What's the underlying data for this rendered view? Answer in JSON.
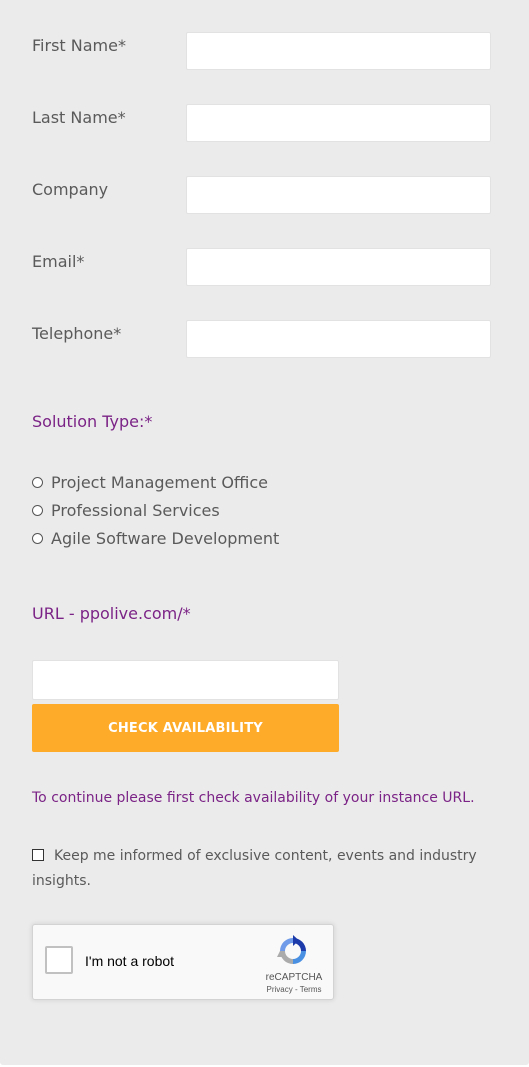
{
  "form": {
    "fields": [
      {
        "label": "First Name*",
        "value": ""
      },
      {
        "label": "Last Name*",
        "value": ""
      },
      {
        "label": "Company",
        "value": ""
      },
      {
        "label": "Email*",
        "value": ""
      },
      {
        "label": "Telephone*",
        "value": ""
      }
    ],
    "solution": {
      "title": "Solution Type:*",
      "options": [
        "Project Management Office",
        "Professional Services",
        "Agile Software Development"
      ]
    },
    "url": {
      "title": "URL - ppolive.com/*",
      "value": "",
      "button_label": "CHECK AVAILABILITY",
      "notice": "To continue please first check availability of your instance URL."
    },
    "consent": {
      "checked": false,
      "text": "Keep me informed of exclusive content, events and industry insights."
    },
    "captcha": {
      "label": "I'm not a robot",
      "brand": "reCAPTCHA",
      "privacy": "Privacy",
      "separator": " - ",
      "terms": "Terms"
    }
  },
  "colors": {
    "accent_purple": "#7b2386",
    "button_orange": "#fdab29",
    "panel_bg": "#ebebeb"
  }
}
